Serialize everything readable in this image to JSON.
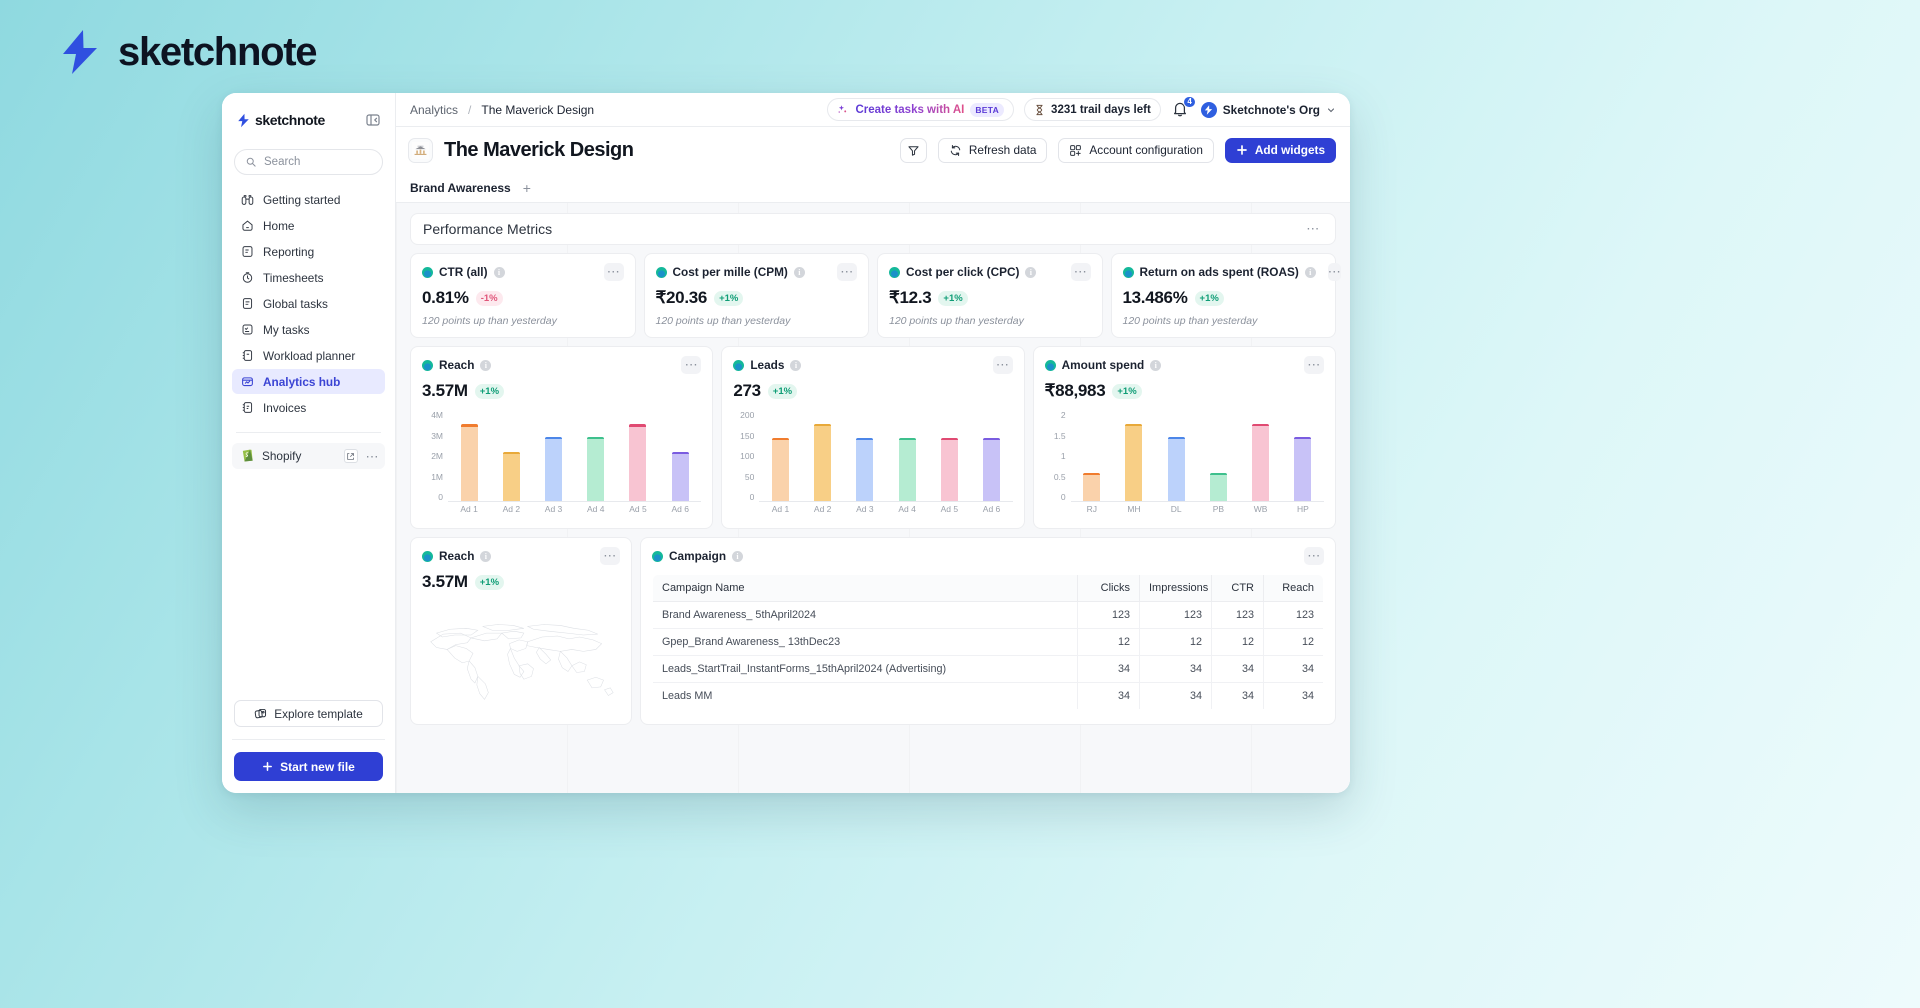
{
  "brand": {
    "name": "sketchnote"
  },
  "sidebar": {
    "logo": "sketchnote",
    "search_placeholder": "Search",
    "items": [
      {
        "label": "Getting started",
        "icon": "binoculars-icon",
        "active": false
      },
      {
        "label": "Home",
        "icon": "home-icon",
        "active": false
      },
      {
        "label": "Reporting",
        "icon": "report-icon",
        "active": false
      },
      {
        "label": "Timesheets",
        "icon": "timer-icon",
        "active": false
      },
      {
        "label": "Global tasks",
        "icon": "list-icon",
        "active": false
      },
      {
        "label": "My tasks",
        "icon": "checklist-icon",
        "active": false
      },
      {
        "label": "Workload planner",
        "icon": "planner-icon",
        "active": false
      },
      {
        "label": "Analytics hub",
        "icon": "analytics-icon",
        "active": true
      },
      {
        "label": "Invoices",
        "icon": "invoice-icon",
        "active": false
      }
    ],
    "app": {
      "label": "Shopify",
      "icon": "shopify-icon"
    },
    "explore_label": "Explore template",
    "new_file_label": "Start new file"
  },
  "topbar": {
    "breadcrumb": {
      "root": "Analytics",
      "separator": "/",
      "current": "The Maverick Design"
    },
    "ai_button": {
      "label": "Create tasks with AI",
      "badge": "BETA"
    },
    "trial": "3231 trail days left",
    "notifications": "4",
    "org": "Sketchnote's Org"
  },
  "title_row": {
    "title": "The Maverick Design",
    "buttons": [
      {
        "label": "Refresh data",
        "icon": "refresh-icon"
      },
      {
        "label": "Account configuration",
        "icon": "grid-plus-icon"
      },
      {
        "label": "Add widgets",
        "icon": "plus-icon"
      }
    ],
    "filter_icon": "filter-icon"
  },
  "tabs": {
    "items": [
      {
        "label": "Brand Awareness"
      }
    ],
    "add": "+"
  },
  "section": {
    "title": "Performance Metrics",
    "menu": "⋯"
  },
  "kpis": [
    {
      "title": "CTR (all)",
      "value": "0.81%",
      "delta": "-1%",
      "dir": "down",
      "sub": "120 points up than yesterday"
    },
    {
      "title": "Cost per mille (CPM)",
      "value": "₹20.36",
      "delta": "+1%",
      "dir": "up",
      "sub": "120 points up than yesterday"
    },
    {
      "title": "Cost per click (CPC)",
      "value": "₹12.3",
      "delta": "+1%",
      "dir": "up",
      "sub": "120 points up than yesterday"
    },
    {
      "title": "Return on ads spent (ROAS)",
      "value": "13.486%",
      "delta": "+1%",
      "dir": "up",
      "sub": "120 points up than yesterday"
    }
  ],
  "chart_data": [
    {
      "type": "bar",
      "title": "Reach",
      "headline_value": "3.57M",
      "delta": "+1%",
      "categories": [
        "Ad 1",
        "Ad 2",
        "Ad 3",
        "Ad 4",
        "Ad 5",
        "Ad 6"
      ],
      "values": [
        3.35,
        2.15,
        2.8,
        2.8,
        3.35,
        2.15
      ],
      "ticks": [
        "4M",
        "3M",
        "2M",
        "1M",
        "0"
      ],
      "ylim": [
        0,
        4
      ],
      "xlabel": "",
      "ylabel": "",
      "grid": false,
      "legend": "none",
      "colors": [
        "#fad2ab",
        "#f8cf86",
        "#bcd2fb",
        "#b5ecd2",
        "#f8c4d2",
        "#c8c2f7"
      ],
      "caps": [
        "#f07c2e",
        "#e8a93a",
        "#4c86e8",
        "#3ec08d",
        "#e04a72",
        "#7a5ce0"
      ]
    },
    {
      "type": "bar",
      "title": "Leads",
      "headline_value": "273",
      "delta": "+1%",
      "categories": [
        "Ad 1",
        "Ad 2",
        "Ad 3",
        "Ad 4",
        "Ad 5",
        "Ad 6"
      ],
      "values": [
        138,
        168,
        138,
        138,
        138,
        138
      ],
      "ticks": [
        "200",
        "150",
        "100",
        "50",
        "0"
      ],
      "ylim": [
        0,
        200
      ],
      "xlabel": "",
      "ylabel": "",
      "grid": false,
      "legend": "none",
      "colors": [
        "#fad2ab",
        "#f8cf86",
        "#bcd2fb",
        "#b5ecd2",
        "#f8c4d2",
        "#c8c2f7"
      ],
      "caps": [
        "#f07c2e",
        "#e8a93a",
        "#4c86e8",
        "#3ec08d",
        "#e04a72",
        "#7a5ce0"
      ]
    },
    {
      "type": "bar",
      "title": "Amount spend",
      "headline_value": "₹88,983",
      "delta": "+1%",
      "categories": [
        "RJ",
        "MH",
        "DL",
        "PB",
        "WB",
        "HP"
      ],
      "values": [
        0.62,
        1.68,
        1.4,
        0.62,
        1.68,
        1.4
      ],
      "ticks": [
        "2",
        "1.5",
        "1",
        "0.5",
        "0"
      ],
      "ylim": [
        0,
        2
      ],
      "xlabel": "",
      "ylabel": "",
      "grid": false,
      "legend": "none",
      "colors": [
        "#fad2ab",
        "#f8cf86",
        "#bcd2fb",
        "#b5ecd2",
        "#f8c4d2",
        "#c8c2f7"
      ],
      "caps": [
        "#f07c2e",
        "#e8a93a",
        "#4c86e8",
        "#3ec08d",
        "#e04a72",
        "#7a5ce0"
      ]
    }
  ],
  "map_card": {
    "title": "Reach",
    "value": "3.57M",
    "delta": "+1%"
  },
  "campaign": {
    "title": "Campaign",
    "columns": [
      "Campaign Name",
      "Clicks",
      "Impressions",
      "CTR",
      "Reach"
    ],
    "rows": [
      [
        "Brand Awareness_ 5thApril2024",
        "123",
        "123",
        "123",
        "123"
      ],
      [
        "Gpep_Brand Awareness_ 13thDec23",
        "12",
        "12",
        "12",
        "12"
      ],
      [
        "Leads_StartTrail_InstantForms_15thApril2024 (Advertising)",
        "34",
        "34",
        "34",
        "34"
      ],
      [
        "Leads MM",
        "34",
        "34",
        "34",
        "34"
      ]
    ]
  },
  "colors": {
    "accent": "#2f3fd4",
    "up": "#0f9d76",
    "down": "#e0567a",
    "sidebar_active_bg": "#e8eaff"
  }
}
